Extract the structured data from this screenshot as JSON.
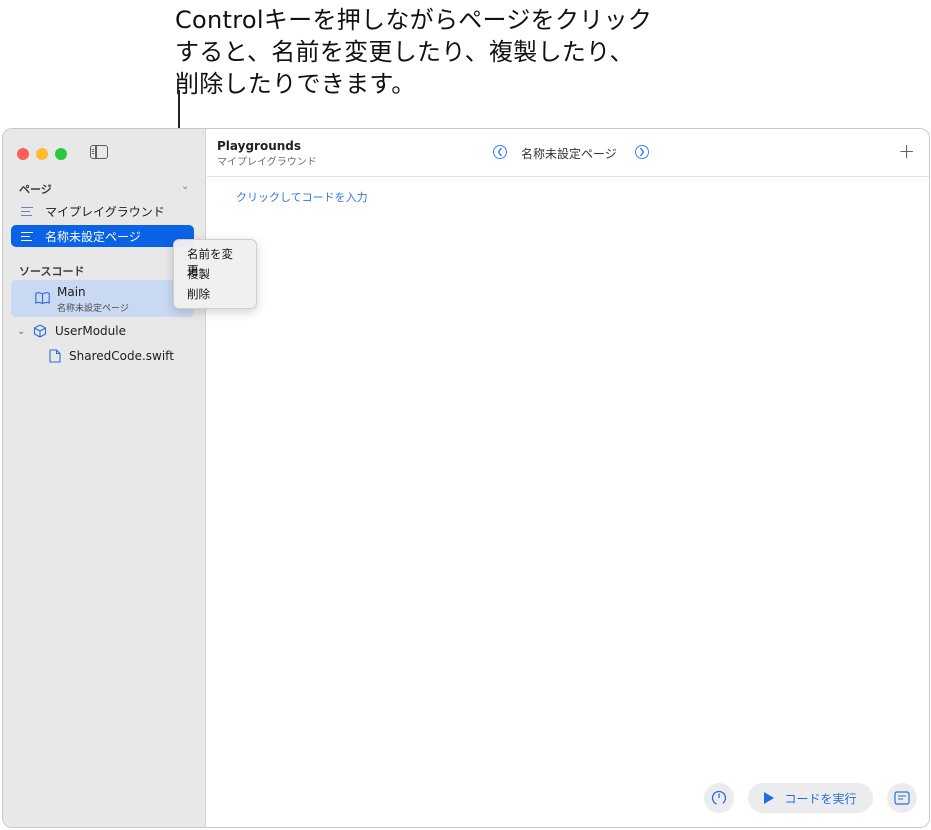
{
  "callout": {
    "line1": "Controlキーを押しながらページをクリック",
    "line2": "すると、名前を変更したり、複製したり、",
    "line3": "削除したりできます。"
  },
  "window": {
    "traffic_lights": [
      "close",
      "minimize",
      "zoom"
    ]
  },
  "sidebar": {
    "pages_header": "ページ",
    "pages": [
      {
        "label": "マイプレイグラウンド",
        "icon": "text-lines-icon",
        "selected": false
      },
      {
        "label": "名称未設定ページ",
        "icon": "text-lines-icon",
        "selected": true
      }
    ],
    "source_header": "ソースコード",
    "main_item": {
      "title": "Main",
      "subtitle": "名称未設定ページ",
      "icon": "book-icon"
    },
    "module": {
      "label": "UserModule",
      "icon": "cube-icon"
    },
    "file": {
      "label": "SharedCode.swift",
      "icon": "document-icon"
    }
  },
  "context_menu": {
    "items": [
      "名前を変更",
      "複製",
      "削除"
    ]
  },
  "toolbar": {
    "title": "Playgrounds",
    "subtitle": "マイプレイグラウンド",
    "page_name": "名称未設定ページ",
    "prev_icon": "chevron-left-circle-icon",
    "next_icon": "chevron-right-circle-icon",
    "add_icon": "plus-icon",
    "add_symbol": "+"
  },
  "editor": {
    "placeholder": "クリックしてコードを入力"
  },
  "bottom_bar": {
    "run_label": "コードを実行",
    "speed_icon": "gauge-icon",
    "doc_icon": "console-icon"
  },
  "colors": {
    "accent": "#0a63e6",
    "sidebar_bg": "#e8e8e9",
    "selection_light": "#c9d9f2",
    "link": "#2f7bd9"
  }
}
